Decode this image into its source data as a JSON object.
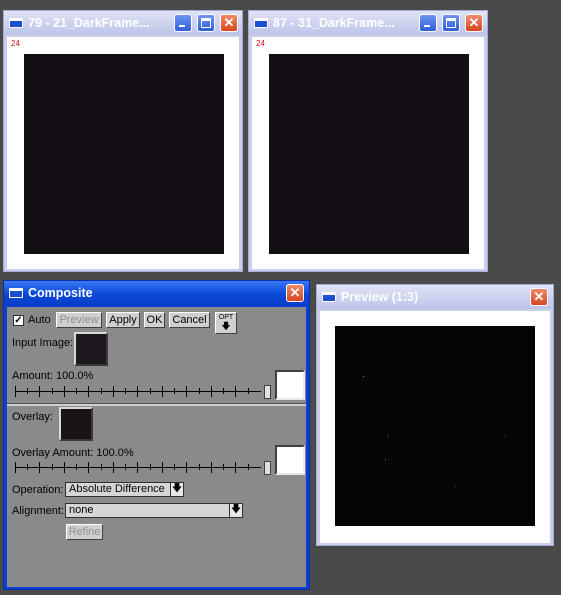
{
  "windows": {
    "frame_a": {
      "title": "79 - 21_DarkFrame...",
      "badge": "24"
    },
    "frame_b": {
      "title": "87 - 31_DarkFrame...",
      "badge": "24"
    },
    "preview": {
      "title": "Preview (1:3)"
    },
    "composite": {
      "title": "Composite"
    }
  },
  "composite": {
    "auto_label": "Auto",
    "auto_checked": true,
    "check_mark": "✓",
    "preview_button": "Preview",
    "apply_button": "Apply",
    "ok_button": "OK",
    "cancel_button": "Cancel",
    "opt_button": "OPT",
    "opt_arrow": "🡇",
    "input_image_label": "Input Image:",
    "amount_label": "Amount: 100.0%",
    "amount_value": 100.0,
    "overlay_label": "Overlay:",
    "overlay_amount_label": "Overlay Amount: 100.0%",
    "overlay_amount_value": 100.0,
    "operation_label": "Operation:",
    "operation_value": "Absolute Difference",
    "alignment_label": "Alignment:",
    "alignment_value": "none",
    "refine_button": "Refine",
    "dropdown_arrow": "🡇"
  },
  "title_buttons": {
    "close_glyph": "✕"
  },
  "colors": {
    "dark_frame": "#130d14",
    "active_titlebar": "#0a49d8",
    "inactive_titlebar": "#c9cfe9",
    "panel_bg": "#8a8a8a"
  }
}
